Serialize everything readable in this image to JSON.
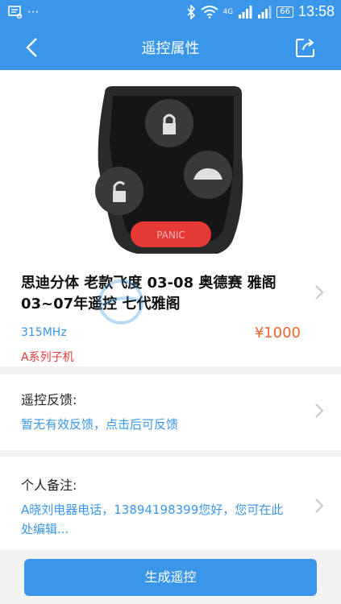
{
  "status_bar": {
    "left_icon": "message-icon",
    "dots": "···",
    "network_label": "4G",
    "battery": "66",
    "time": "13:58"
  },
  "nav": {
    "title": "遥控属性",
    "back_icon": "chevron-left-icon",
    "share_icon": "share-icon"
  },
  "product": {
    "title": "思迪分体 老款飞度 03-08 奥德赛 雅阁03~07年遥控 七代雅阁",
    "frequency": "315MHz",
    "price": "¥1000",
    "series": "A系列子机",
    "image_button_text": "PANIC"
  },
  "feedback": {
    "label": "遥控反馈:",
    "value": "暂无有效反馈，点击后可反馈"
  },
  "notes": {
    "label": "个人备注:",
    "value": "A晓刘电器电话，13894198399您好，您可在此处编辑..."
  },
  "generate_button": "生成遥控",
  "colors": {
    "primary": "#3a96e8",
    "price": "#f3642a",
    "series": "#e53935"
  }
}
